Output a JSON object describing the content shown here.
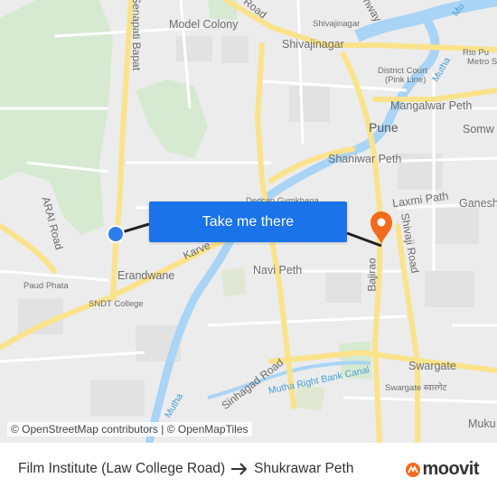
{
  "map": {
    "labels": {
      "model_colony": "Model Colony",
      "shivajinagar": "Shivajinagar",
      "shivajinagar_small": "Shivajinagar",
      "rto_pune": "Rto Pu",
      "metro_station": "Metro S",
      "district_court": "District Court",
      "pink_line": "(Pink Line)",
      "mangalwar_peth": "Mangalwar Peth",
      "pune": "Pune",
      "somwar": "Somw",
      "shaniwar_peth": "Shaniwar Peth",
      "laxmi_path": "Laxmi Path",
      "ganesh": "Ganesh",
      "deccan_gymkhana": "Deccan Gymkhana",
      "arai_road": "ARAI Road",
      "senapati_bapat": "Senapati Bapat",
      "road_top": "Road",
      "karve": "Karve",
      "erandwane": "Erandwane",
      "paud_phata": "Paud Phata",
      "sndt_college": "SNDT College",
      "navi_peth": "Navi Peth",
      "bajirao": "Bajirao",
      "shivaji_road": "Shivaji Road",
      "swargate": "Swargate",
      "swargate_local": "Swargate स्वारगेट",
      "sinhagad_road": "Sinhagad Road",
      "mutha_canal": "Mutha Right Bank Canal",
      "mutha_river": "Mutha",
      "mutha_top": "Mutha",
      "mutha_bottom": "Mutha",
      "mukund": "Muku",
      "highway": "hway",
      "mula_top": "Mu"
    },
    "cta": "Take me there",
    "attribution": {
      "osm": "© OpenStreetMap contributors",
      "sep": "|",
      "omt": "© OpenMapTiles"
    },
    "colors": {
      "origin": "#2b7de9",
      "destination": "#f26a1b",
      "button": "#1a73e8",
      "water": "#a9d4f5",
      "park": "#d6ead1",
      "major_road": "#fbe38b"
    }
  },
  "footer": {
    "origin": "Film Institute (Law College Road)",
    "destination": "Shukrawar Peth",
    "brand": "moovit"
  }
}
